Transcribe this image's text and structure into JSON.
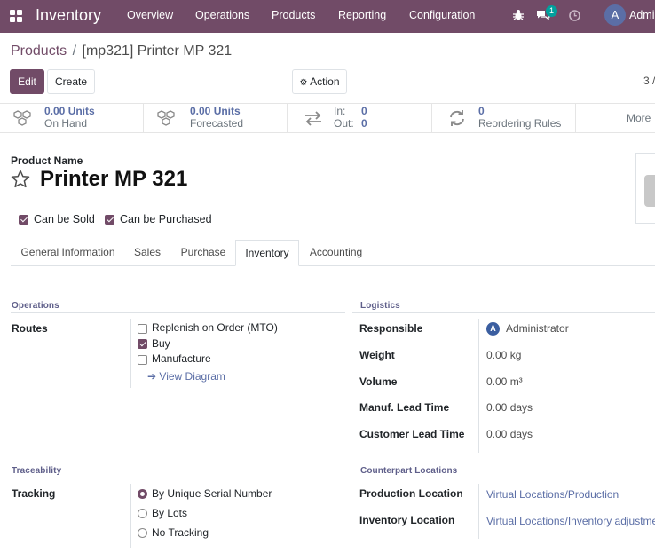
{
  "topbar": {
    "app_name": "Inventory",
    "menu": [
      "Overview",
      "Operations",
      "Products",
      "Reporting",
      "Configuration"
    ],
    "messages_badge": "1",
    "user_initial": "A",
    "user_name": "Admi"
  },
  "breadcrumb": {
    "parent": "Products",
    "separator": "/",
    "current": "[mp321] Printer MP 321"
  },
  "toolbar": {
    "edit": "Edit",
    "create": "Create",
    "action": "Action",
    "pager": "3 /"
  },
  "stats": [
    {
      "value": "0.00 Units",
      "label": "On Hand",
      "icon": "cubes-icon"
    },
    {
      "value": "0.00 Units",
      "label": "Forecasted",
      "icon": "cubes-icon"
    },
    {
      "in_label": "In:",
      "in_value": "0",
      "out_label": "Out:",
      "out_value": "0",
      "icon": "exchange-icon"
    },
    {
      "value": "0",
      "label": "Reordering Rules",
      "icon": "refresh-icon"
    }
  ],
  "more": "More",
  "product": {
    "field_label": "Product Name",
    "name": "Printer MP 321",
    "can_be_sold": "Can be Sold",
    "can_be_purchased": "Can be Purchased"
  },
  "tabs": [
    "General Information",
    "Sales",
    "Purchase",
    "Inventory",
    "Accounting"
  ],
  "active_tab": "Inventory",
  "operations": {
    "title": "Operations",
    "routes_label": "Routes",
    "routes": [
      {
        "label": "Replenish on Order (MTO)",
        "checked": false
      },
      {
        "label": "Buy",
        "checked": true
      },
      {
        "label": "Manufacture",
        "checked": false
      }
    ],
    "view_diagram": "View Diagram"
  },
  "logistics": {
    "title": "Logistics",
    "responsible_label": "Responsible",
    "responsible_initial": "A",
    "responsible": "Administrator",
    "weight_label": "Weight",
    "weight": "0.00 kg",
    "volume_label": "Volume",
    "volume": "0.00 m³",
    "manuf_lead_label": "Manuf. Lead Time",
    "manuf_lead": "0.00 days",
    "customer_lead_label": "Customer Lead Time",
    "customer_lead": "0.00 days"
  },
  "traceability": {
    "title": "Traceability",
    "tracking_label": "Tracking",
    "options": [
      {
        "label": "By Unique Serial Number",
        "selected": true
      },
      {
        "label": "By Lots",
        "selected": false
      },
      {
        "label": "No Tracking",
        "selected": false
      }
    ]
  },
  "counterpart": {
    "title": "Counterpart Locations",
    "production_label": "Production Location",
    "production": "Virtual Locations/Production",
    "inventory_label": "Inventory Location",
    "inventory": "Virtual Locations/Inventory adjustmen"
  },
  "colors": {
    "brand": "#714b67",
    "link": "#5b6ea6",
    "badge": "#00a09d"
  }
}
